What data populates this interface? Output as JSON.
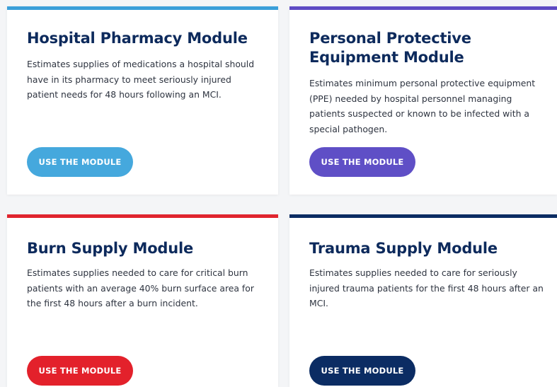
{
  "modules": [
    {
      "title": "Hospital Pharmacy Module",
      "description": "Estimates supplies of medications a hospital should have in its pharmacy to meet seriously injured patient needs for 48 hours following an MCI.",
      "button_label": "USE THE MODULE",
      "accent_color": "#3a9fd9",
      "button_color": "#45a8dd"
    },
    {
      "title": "Personal Protective Equipment Module",
      "description": "Estimates minimum personal protective equipment (PPE) needed by hospital personnel managing patients suspected or known to be infected with a special pathogen.",
      "button_label": "USE THE MODULE",
      "accent_color": "#5e4bc4",
      "button_color": "#5f4fc6"
    },
    {
      "title": "Burn Supply Module",
      "description": "Estimates supplies needed to care for critical burn patients with an average 40% burn surface area for the first 48 hours after a burn incident.",
      "button_label": "USE THE MODULE",
      "accent_color": "#e0242e",
      "button_color": "#e3212b"
    },
    {
      "title": "Trauma Supply Module",
      "description": "Estimates supplies needed to care for seriously injured trauma patients for the first 48 hours after an MCI.",
      "button_label": "USE THE MODULE",
      "accent_color": "#0b2c63",
      "button_color": "#0b2c63"
    }
  ]
}
